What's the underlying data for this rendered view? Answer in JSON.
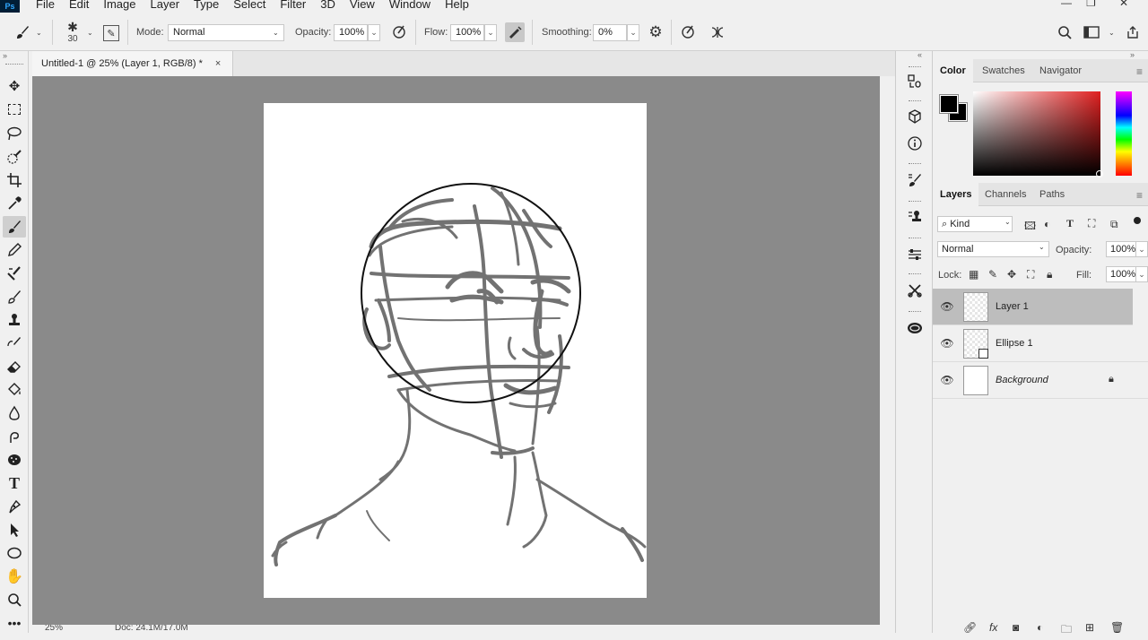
{
  "menubar": {
    "logo": "Ps",
    "items": [
      "File",
      "Edit",
      "Image",
      "Layer",
      "Type",
      "Select",
      "Filter",
      "3D",
      "View",
      "Window",
      "Help"
    ]
  },
  "options": {
    "brush_size": "30",
    "mode_label": "Mode:",
    "mode_value": "Normal",
    "opacity_label": "Opacity:",
    "opacity_value": "100%",
    "flow_label": "Flow:",
    "flow_value": "100%",
    "smoothing_label": "Smoothing:",
    "smoothing_value": "0%"
  },
  "document": {
    "tab_title": "Untitled-1 @ 25% (Layer 1, RGB/8) *",
    "close_glyph": "×",
    "zoom": "25%",
    "doc_info": "Doc: 24.1M/17.0M"
  },
  "color_panel": {
    "tabs": [
      "Color",
      "Swatches",
      "Navigator"
    ],
    "foreground": "#000000",
    "background": "#000000"
  },
  "layers_panel": {
    "tabs": [
      "Layers",
      "Channels",
      "Paths"
    ],
    "filter_value": "Kind",
    "blend_mode": "Normal",
    "opacity_label": "Opacity:",
    "opacity_value": "100%",
    "lock_label": "Lock:",
    "fill_label": "Fill:",
    "fill_value": "100%",
    "layers": [
      {
        "name": "Layer 1",
        "selected": true
      },
      {
        "name": "Ellipse 1",
        "selected": false
      },
      {
        "name": "Background",
        "selected": false
      }
    ]
  },
  "colors": {
    "canvas_bg": "#8a8a8a",
    "ui_bg": "#f0f0f0",
    "selected_layer": "#bdbdbd"
  }
}
